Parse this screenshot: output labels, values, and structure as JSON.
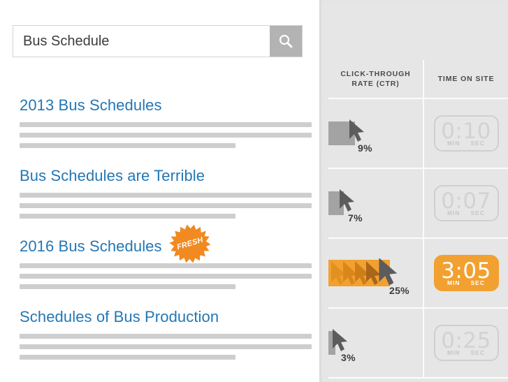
{
  "search": {
    "value": "Bus Schedule",
    "placeholder": "Search",
    "button_icon": "search-icon"
  },
  "results": [
    {
      "title": "2013 Bus Schedules",
      "badge": null
    },
    {
      "title": "Bus Schedules are Terrible",
      "badge": null
    },
    {
      "title": "2016 Bus Schedules",
      "badge": "FRESH"
    },
    {
      "title": "Schedules of Bus Production",
      "badge": null
    }
  ],
  "metrics_panel": {
    "headers": {
      "ctr_line1": "CLICK-THROUGH",
      "ctr_line2": "RATE (CTR)",
      "time": "TIME ON SITE"
    },
    "rows": [
      {
        "ctr": "9%",
        "ctr_value": 9,
        "time": "0:10",
        "min_label": "MIN",
        "sec_label": "SEC",
        "highlight": false
      },
      {
        "ctr": "7%",
        "ctr_value": 7,
        "time": "0:07",
        "min_label": "MIN",
        "sec_label": "SEC",
        "highlight": false
      },
      {
        "ctr": "25%",
        "ctr_value": 25,
        "time": "3:05",
        "min_label": "MIN",
        "sec_label": "SEC",
        "highlight": true
      },
      {
        "ctr": "3%",
        "ctr_value": 3,
        "time": "0:25",
        "min_label": "MIN",
        "sec_label": "SEC",
        "highlight": false
      }
    ]
  },
  "colors": {
    "accent_orange": "#f2a030",
    "link_blue": "#2377b5",
    "panel_bg": "#e6e6e6",
    "bar_gray": "#a3a3a3",
    "placeholder_gray": "#cecece"
  }
}
